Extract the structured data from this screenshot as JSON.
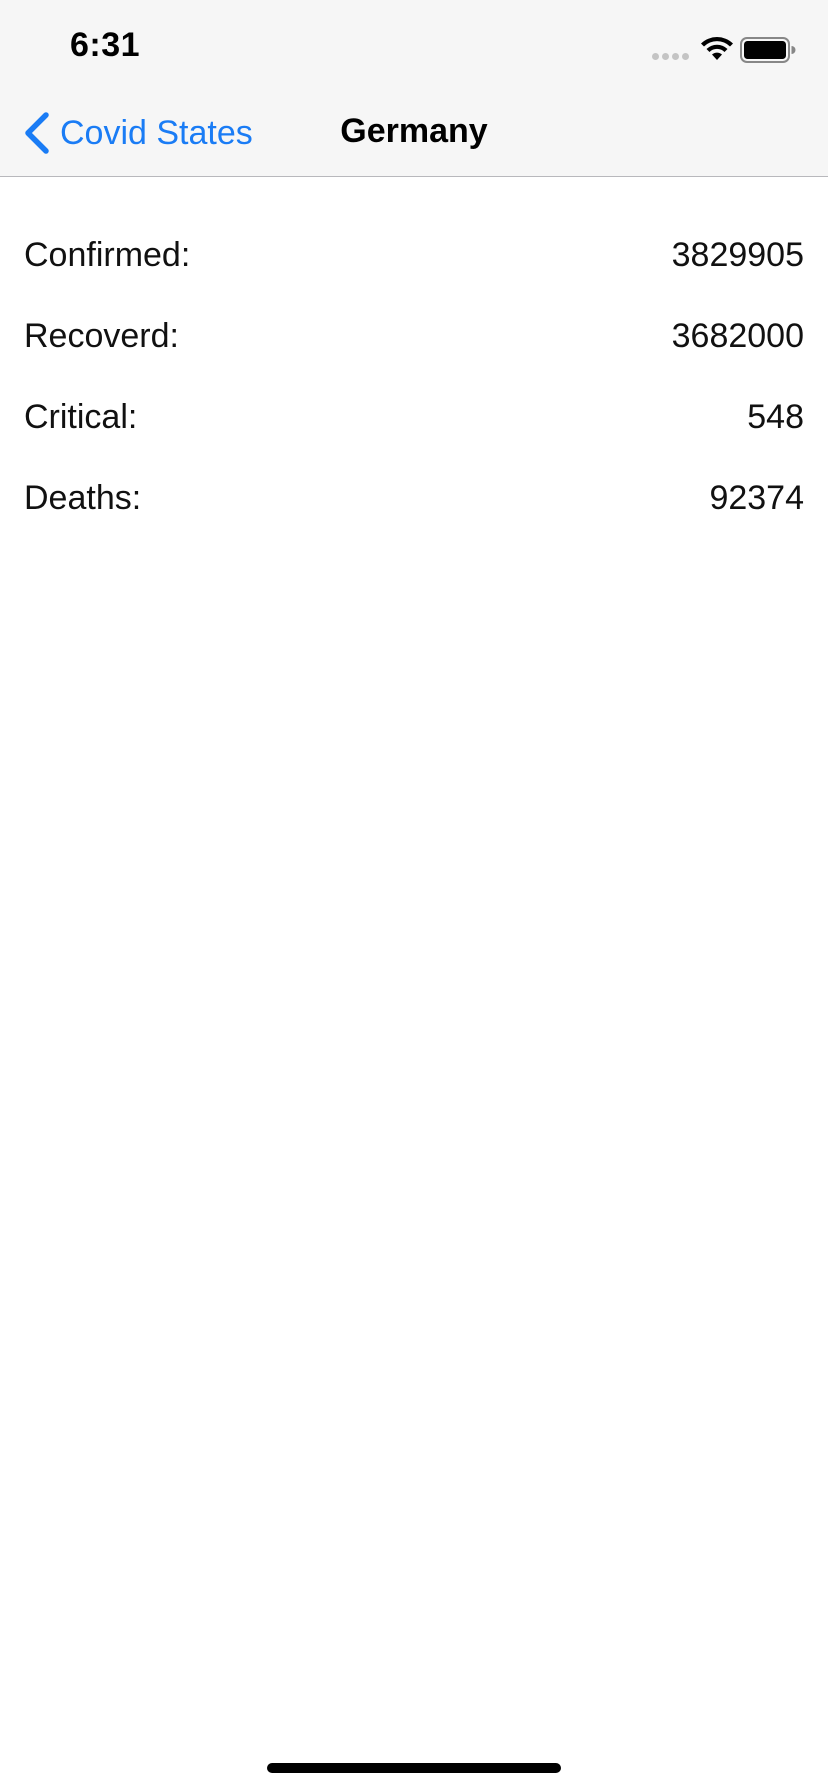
{
  "status_bar": {
    "time": "6:31",
    "icons": [
      "cellular-signal-icon",
      "wifi-icon",
      "battery-icon"
    ]
  },
  "nav": {
    "back_label": "Covid States",
    "title": "Germany",
    "back_icon": "chevron-left-icon",
    "accent_color": "#1a7cf5"
  },
  "stats": [
    {
      "label": "Confirmed:",
      "value": "3829905"
    },
    {
      "label": "Recoverd:",
      "value": "3682000"
    },
    {
      "label": "Critical:",
      "value": "548"
    },
    {
      "label": "Deaths:",
      "value": "92374"
    }
  ]
}
